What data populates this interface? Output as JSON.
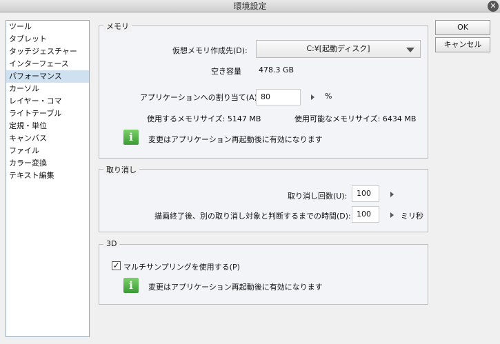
{
  "window": {
    "title": "環境設定",
    "close": "✕"
  },
  "sidebar": {
    "items": [
      "ツール",
      "タブレット",
      "タッチジェスチャー",
      "インターフェース",
      "パフォーマンス",
      "カーソル",
      "レイヤー・コマ",
      "ライトテーブル",
      "定規・単位",
      "キャンバス",
      "ファイル",
      "カラー変換",
      "テキスト編集"
    ],
    "selected": "パフォーマンス"
  },
  "buttons": {
    "ok": "OK",
    "cancel": "キャンセル"
  },
  "memory": {
    "title": "メモリ",
    "vm_label": "仮想メモリ作成先(D):",
    "vm_value": "C:¥[起動ディスク]",
    "free_label": "空き容量",
    "free_value": "478.3 GB",
    "alloc_label": "アプリケーションへの割り当て(A):",
    "alloc_value": "80",
    "alloc_unit": "%",
    "used_label": "使用するメモリサイズ: 5147 MB",
    "avail_label": "使用可能なメモリサイズ: 6434 MB",
    "notice": "変更はアプリケーション再起動後に有効になります"
  },
  "undo": {
    "title": "取り消し",
    "count_label": "取り消し回数(U):",
    "count_value": "100",
    "time_label": "描画終了後、別の取り消し対象と判断するまでの時間(D):",
    "time_value": "100",
    "time_unit": "ミリ秒"
  },
  "threed": {
    "title": "3D",
    "multisample_label": "マルチサンプリングを使用する(P)",
    "multisample_checked": true,
    "notice": "変更はアプリケーション再起動後に有効になります"
  }
}
